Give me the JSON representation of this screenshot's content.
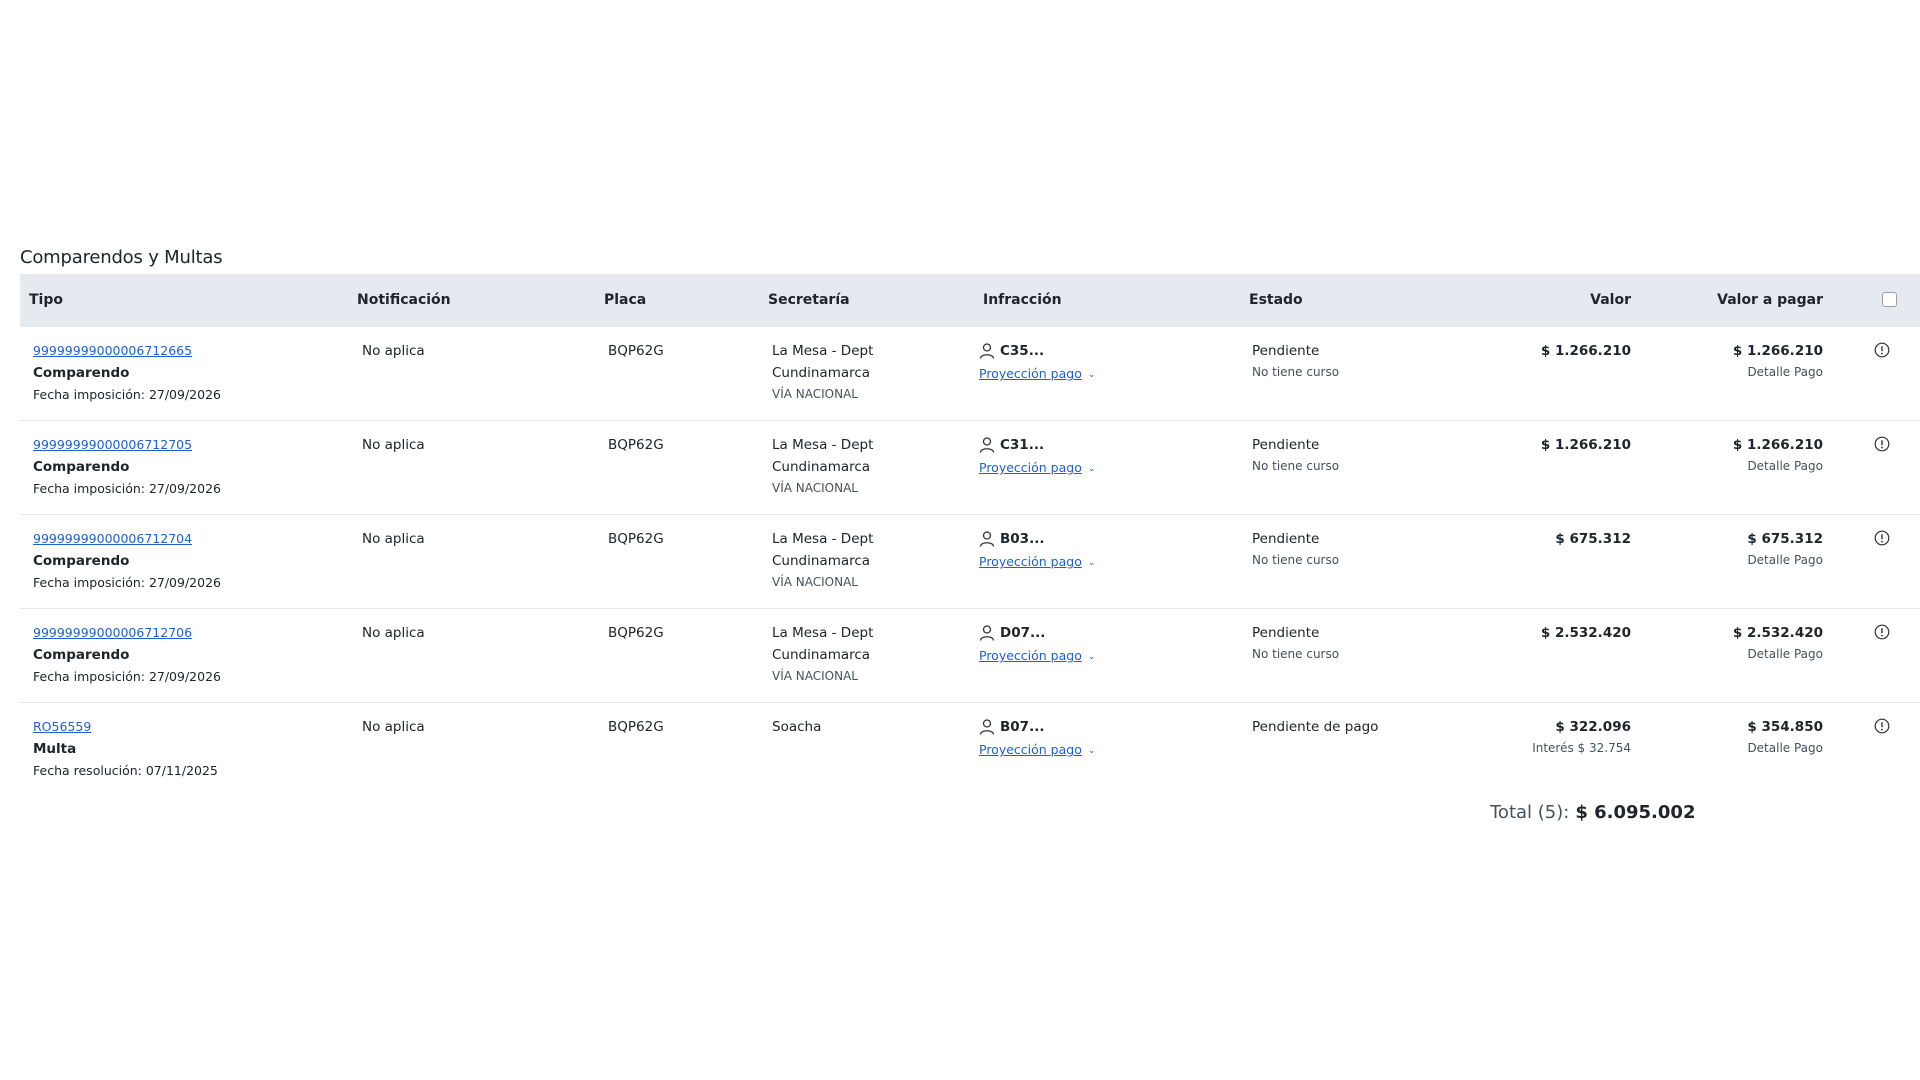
{
  "section": {
    "title": "Comparendos y Multas"
  },
  "headers": {
    "tipo": "Tipo",
    "notificacion": "Notificación",
    "placa": "Placa",
    "secretaria": "Secretaría",
    "infraccion": "Infracción",
    "estado": "Estado",
    "valor": "Valor",
    "valor_pagar": "Valor a pagar"
  },
  "rows": [
    {
      "id": "99999999000006712665",
      "tipo": "Comparendo",
      "fecha": "Fecha imposición: 27/09/2026",
      "notificacion": "No aplica",
      "placa": "BQP62G",
      "secretaria_1": "La Mesa - Dept",
      "secretaria_2": "Cundinamarca",
      "secretaria_3": "VÍA NACIONAL",
      "infraccion": "C35...",
      "proyeccion": "Proyección pago",
      "estado": "Pendiente",
      "estado_sub": "No tiene curso",
      "valor": "$ 1.266.210",
      "valor_sub": "",
      "valor_pagar": "$ 1.266.210",
      "detalle": "Detalle Pago"
    },
    {
      "id": "99999999000006712705",
      "tipo": "Comparendo",
      "fecha": "Fecha imposición: 27/09/2026",
      "notificacion": "No aplica",
      "placa": "BQP62G",
      "secretaria_1": "La Mesa - Dept",
      "secretaria_2": "Cundinamarca",
      "secretaria_3": "VÍA NACIONAL",
      "infraccion": "C31...",
      "proyeccion": "Proyección pago",
      "estado": "Pendiente",
      "estado_sub": "No tiene curso",
      "valor": "$ 1.266.210",
      "valor_sub": "",
      "valor_pagar": "$ 1.266.210",
      "detalle": "Detalle Pago"
    },
    {
      "id": "99999999000006712704",
      "tipo": "Comparendo",
      "fecha": "Fecha imposición: 27/09/2026",
      "notificacion": "No aplica",
      "placa": "BQP62G",
      "secretaria_1": "La Mesa - Dept",
      "secretaria_2": "Cundinamarca",
      "secretaria_3": "VÍA NACIONAL",
      "infraccion": "B03...",
      "proyeccion": "Proyección pago",
      "estado": "Pendiente",
      "estado_sub": "No tiene curso",
      "valor": "$ 675.312",
      "valor_sub": "",
      "valor_pagar": "$ 675.312",
      "detalle": "Detalle Pago"
    },
    {
      "id": "99999999000006712706",
      "tipo": "Comparendo",
      "fecha": "Fecha imposición: 27/09/2026",
      "notificacion": "No aplica",
      "placa": "BQP62G",
      "secretaria_1": "La Mesa - Dept",
      "secretaria_2": "Cundinamarca",
      "secretaria_3": "VÍA NACIONAL",
      "infraccion": "D07...",
      "proyeccion": "Proyección pago",
      "estado": "Pendiente",
      "estado_sub": "No tiene curso",
      "valor": "$ 2.532.420",
      "valor_sub": "",
      "valor_pagar": "$ 2.532.420",
      "detalle": "Detalle Pago"
    },
    {
      "id": "RO56559",
      "tipo": "Multa",
      "fecha": "Fecha resolución: 07/11/2025",
      "notificacion": "No aplica",
      "placa": "BQP62G",
      "secretaria_1": "Soacha",
      "secretaria_2": "",
      "secretaria_3": "",
      "infraccion": "B07...",
      "proyeccion": "Proyección pago",
      "estado": "Pendiente de pago",
      "estado_sub": "",
      "valor": "$ 322.096",
      "valor_sub": "Interés $ 32.754",
      "valor_pagar": "$ 354.850",
      "detalle": "Detalle Pago"
    }
  ],
  "total": {
    "label": "Total (5):",
    "amount": "$ 6.095.002"
  },
  "icons": {
    "person": "person-icon",
    "info": "info-icon",
    "chevron": "chevron-down-icon"
  },
  "colors": {
    "header_bg": "#e6e9ef",
    "link": "#1f5fcf"
  }
}
